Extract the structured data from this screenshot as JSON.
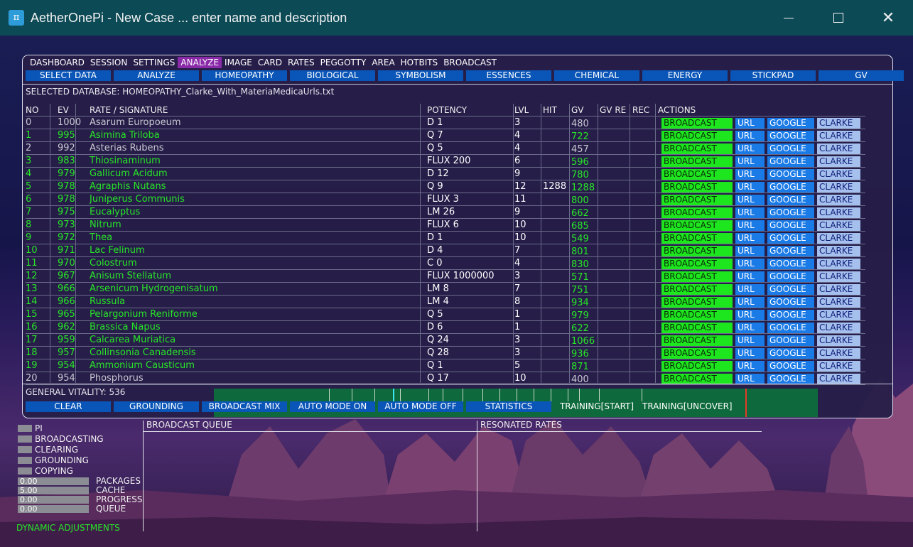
{
  "window": {
    "app_icon": "π",
    "title": "AetherOnePi - New Case ... enter name and description",
    "minimize_icon": "minimize-icon",
    "maximize_icon": "maximize-icon",
    "close_glyph": "✕"
  },
  "menu": {
    "items": [
      "DASHBOARD",
      "SESSION",
      "SETTINGS",
      "ANALYZE",
      "IMAGE",
      "CARD",
      "RATES",
      "PEGGOTTY",
      "AREA",
      "HOTBITS",
      "BROADCAST"
    ],
    "active": "ANALYZE"
  },
  "categories": [
    "SELECT DATA",
    "ANALYZE",
    "HOMEOPATHY",
    "BIOLOGICAL",
    "SYMBOLISM",
    "ESSENCES",
    "CHEMICAL",
    "ENERGY",
    "STICKPAD",
    "GV"
  ],
  "selected_database": "SELECTED DATABASE: HOMEOPATHY_Clarke_With_MateriaMedicaUrls.txt",
  "table": {
    "headers": [
      "NO",
      "EV",
      "RATE / SIGNATURE",
      "POTENCY",
      "LVL",
      "HIT",
      "GV",
      "GV RE",
      "REC",
      "ACTIONS"
    ],
    "action_labels": {
      "broadcast": "BROADCAST",
      "url": "URL",
      "google": "GOOGLE",
      "clarke": "CLARKE"
    },
    "rows": [
      {
        "no": "0",
        "ev": "1000",
        "rate": "Asarum Europoeum",
        "potency": "D 1",
        "lvl": "3",
        "hit": "",
        "gv": "480",
        "color": "grey"
      },
      {
        "no": "1",
        "ev": "995",
        "rate": "Asimina Triloba",
        "potency": "Q 7",
        "lvl": "4",
        "hit": "",
        "gv": "722",
        "color": "green"
      },
      {
        "no": "2",
        "ev": "992",
        "rate": "Asterias Rubens",
        "potency": "Q 5",
        "lvl": "4",
        "hit": "",
        "gv": "457",
        "color": "grey"
      },
      {
        "no": "3",
        "ev": "983",
        "rate": "Thiosinaminum",
        "potency": "FLUX 200",
        "lvl": "6",
        "hit": "",
        "gv": "596",
        "color": "green"
      },
      {
        "no": "4",
        "ev": "979",
        "rate": "Gallicum Acidum",
        "potency": "D 12",
        "lvl": "9",
        "hit": "",
        "gv": "780",
        "color": "green"
      },
      {
        "no": "5",
        "ev": "978",
        "rate": "Agraphis Nutans",
        "potency": "Q 9",
        "lvl": "12",
        "hit": "1288",
        "gv": "1288",
        "color": "green"
      },
      {
        "no": "6",
        "ev": "978",
        "rate": "Juniperus Communis",
        "potency": "FLUX 3",
        "lvl": "11",
        "hit": "",
        "gv": "800",
        "color": "green"
      },
      {
        "no": "7",
        "ev": "975",
        "rate": "Eucalyptus",
        "potency": "LM 26",
        "lvl": "9",
        "hit": "",
        "gv": "662",
        "color": "green"
      },
      {
        "no": "8",
        "ev": "973",
        "rate": "Nitrum",
        "potency": "FLUX 6",
        "lvl": "10",
        "hit": "",
        "gv": "685",
        "color": "green"
      },
      {
        "no": "9",
        "ev": "972",
        "rate": "Thea",
        "potency": "D 1",
        "lvl": "10",
        "hit": "",
        "gv": "549",
        "color": "green"
      },
      {
        "no": "10",
        "ev": "971",
        "rate": "Lac Felinum",
        "potency": "D 4",
        "lvl": "7",
        "hit": "",
        "gv": "801",
        "color": "green"
      },
      {
        "no": "11",
        "ev": "970",
        "rate": "Colostrum",
        "potency": "C 0",
        "lvl": "4",
        "hit": "",
        "gv": "830",
        "color": "green"
      },
      {
        "no": "12",
        "ev": "967",
        "rate": "Anisum Stellatum",
        "potency": "FLUX 1000000",
        "lvl": "3",
        "hit": "",
        "gv": "571",
        "color": "green"
      },
      {
        "no": "13",
        "ev": "966",
        "rate": "Arsenicum Hydrogenisatum",
        "potency": "LM 8",
        "lvl": "7",
        "hit": "",
        "gv": "751",
        "color": "green"
      },
      {
        "no": "14",
        "ev": "966",
        "rate": "Russula",
        "potency": "LM 4",
        "lvl": "8",
        "hit": "",
        "gv": "934",
        "color": "green"
      },
      {
        "no": "15",
        "ev": "965",
        "rate": "Pelargonium Reniforme",
        "potency": "Q 5",
        "lvl": "1",
        "hit": "",
        "gv": "979",
        "color": "green"
      },
      {
        "no": "16",
        "ev": "962",
        "rate": "Brassica Napus",
        "potency": "D 6",
        "lvl": "1",
        "hit": "",
        "gv": "622",
        "color": "green"
      },
      {
        "no": "17",
        "ev": "959",
        "rate": "Calcarea Muriatica",
        "potency": "Q 24",
        "lvl": "3",
        "hit": "",
        "gv": "1066",
        "color": "green"
      },
      {
        "no": "18",
        "ev": "957",
        "rate": "Collinsonia Canadensis",
        "potency": "Q 28",
        "lvl": "3",
        "hit": "",
        "gv": "936",
        "color": "green"
      },
      {
        "no": "19",
        "ev": "954",
        "rate": "Ammonium Causticum",
        "potency": "Q 1",
        "lvl": "5",
        "hit": "",
        "gv": "871",
        "color": "green"
      },
      {
        "no": "20",
        "ev": "954",
        "rate": "Phosphorus",
        "potency": "Q 17",
        "lvl": "10",
        "hit": "",
        "gv": "400",
        "color": "grey"
      }
    ]
  },
  "general_vitality": "GENERAL VITALITY: 536",
  "controls": [
    "CLEAR",
    "GROUNDING",
    "BROADCAST MIX",
    "AUTO MODE ON",
    "AUTO MODE OFF",
    "STATISTICS",
    "TRAINING[START]",
    "TRAINING[UNCOVER]"
  ],
  "status_flags": [
    "PI",
    "BROADCASTING",
    "CLEARING",
    "GROUNDING",
    "COPYING"
  ],
  "status_values": [
    {
      "value": "0.00",
      "label": "PACKAGES"
    },
    {
      "value": "5.00",
      "label": "CACHE"
    },
    {
      "value": "0.00",
      "label": "PROGRESS"
    },
    {
      "value": "0.00",
      "label": "QUEUE"
    }
  ],
  "dynamic_adjustments": "DYNAMIC ADJUSTMENTS",
  "broadcast_queue_title": "BROADCAST QUEUE",
  "resonated_rates_title": "RESONATED RATES"
}
